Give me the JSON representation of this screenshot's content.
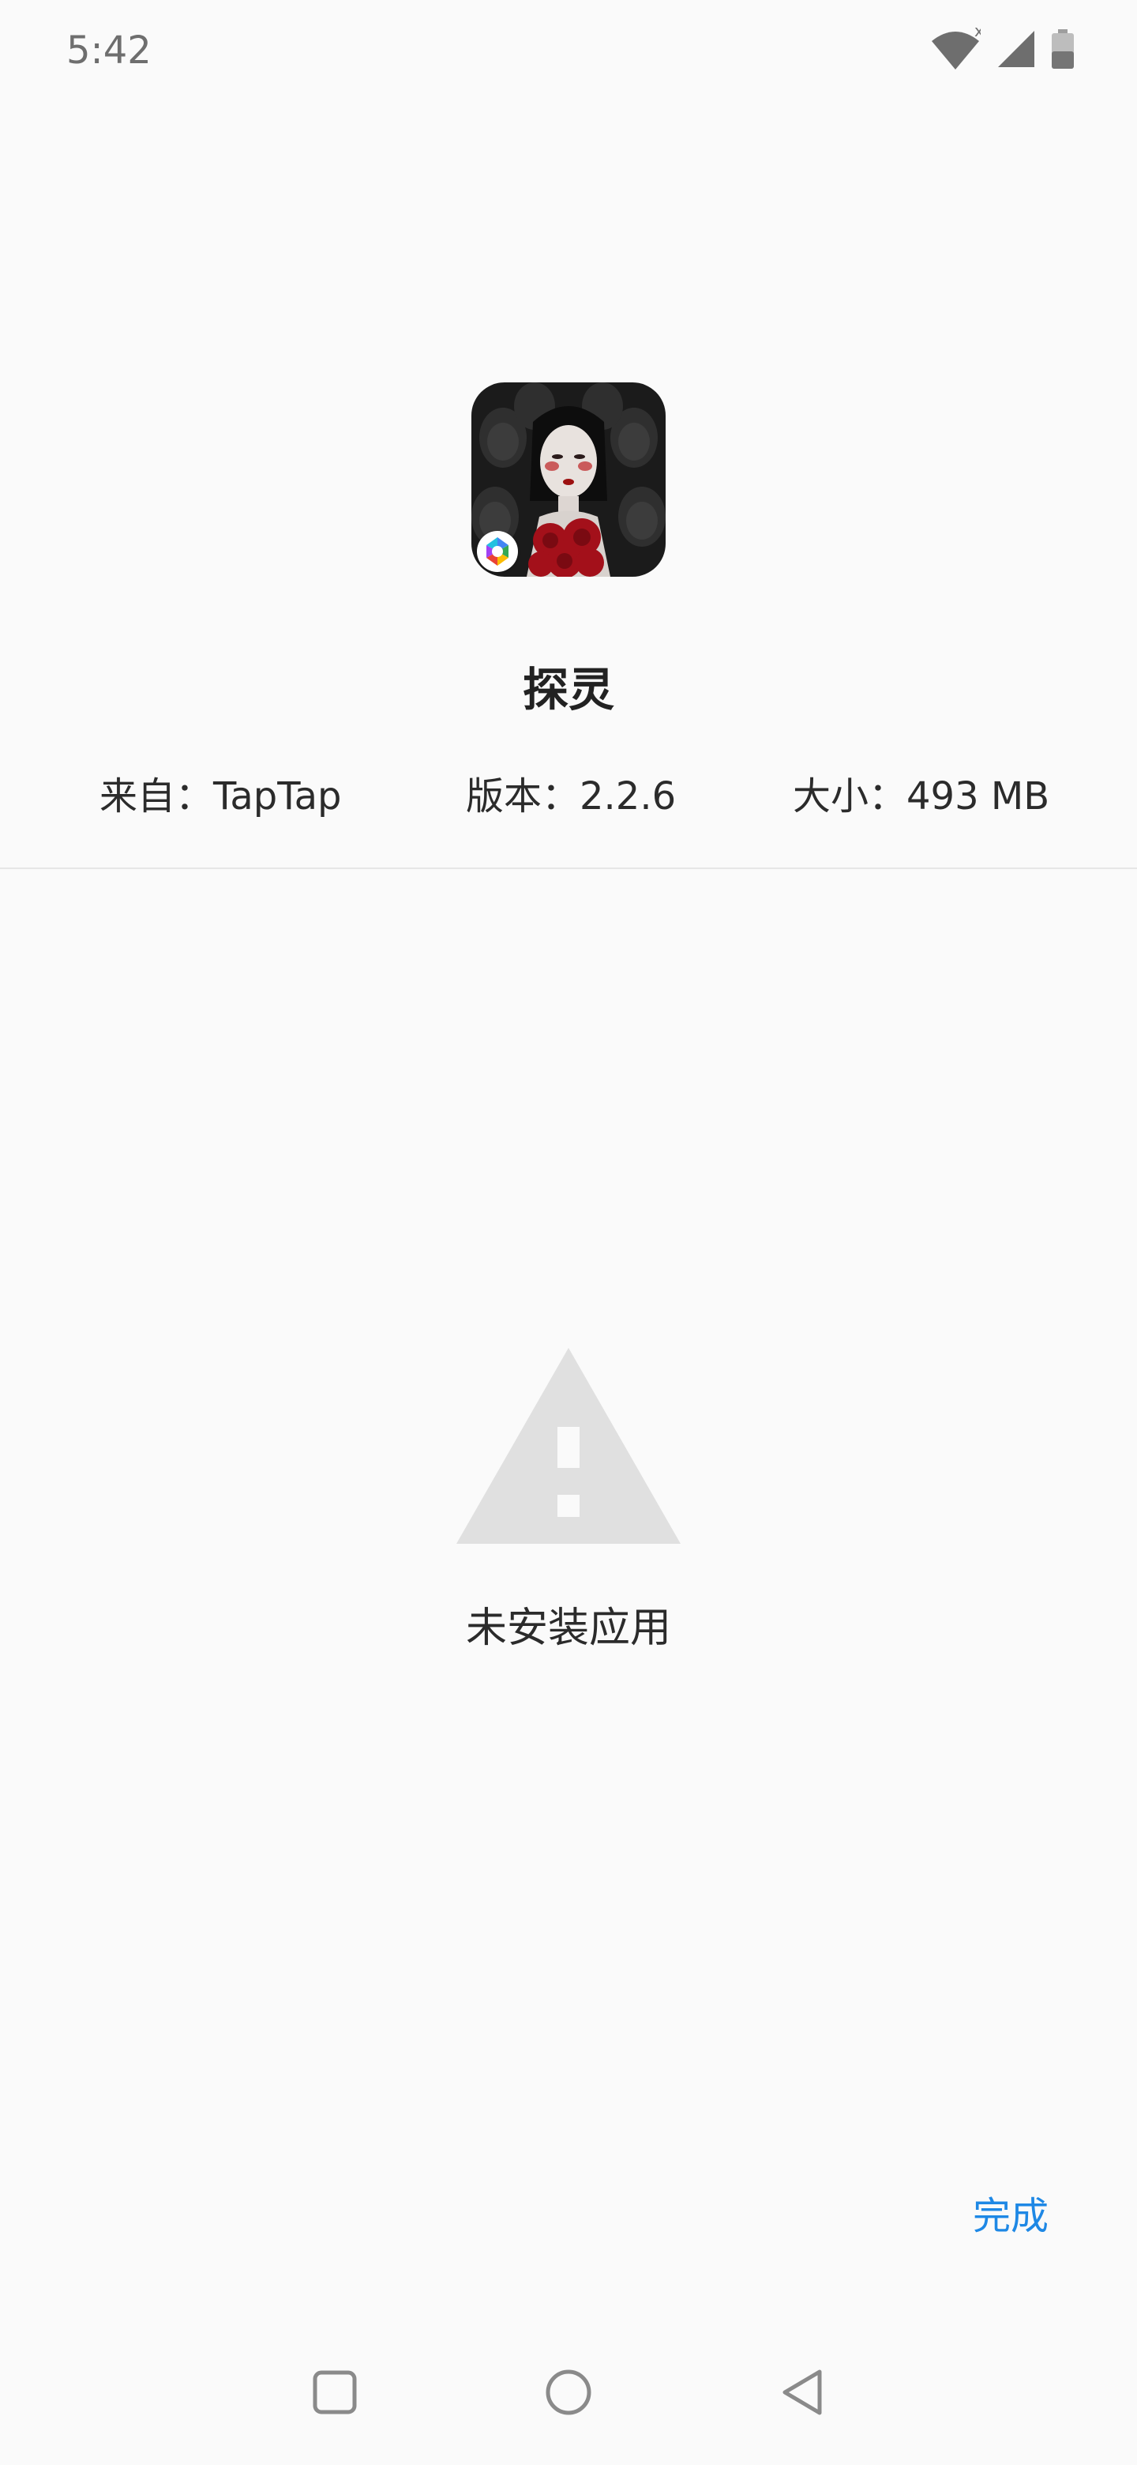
{
  "status_bar": {
    "time": "5:42",
    "icons": [
      "wifi-icon",
      "cell-signal-icon",
      "battery-icon"
    ]
  },
  "app": {
    "name": "探灵",
    "icon_name": "app-icon",
    "badge_icon_name": "installer-badge-icon"
  },
  "meta": {
    "source": "来自：TapTap",
    "version": "版本：2.2.6",
    "size": "大小：493 MB"
  },
  "result": {
    "icon_name": "warning-icon",
    "message": "未安装应用"
  },
  "actions": {
    "done_label": "完成"
  },
  "nav": {
    "recents_icon": "square-icon",
    "home_icon": "circle-icon",
    "back_icon": "triangle-back-icon"
  },
  "colors": {
    "background": "#fafafa",
    "accent": "#1e88e5",
    "warning": "#e0e0e0"
  }
}
